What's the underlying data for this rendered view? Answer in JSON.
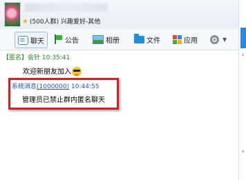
{
  "group": {
    "member_info": "(500人群) 兴趣爱好-其他"
  },
  "toolbar": {
    "chat_label": "聊天",
    "announcement_label": "公告",
    "album_label": "相册",
    "files_label": "文件",
    "apps_label": "应用"
  },
  "messages": [
    {
      "sender": "【匿名】会针",
      "time": "10:35:41",
      "body": "欢迎新朋友加入",
      "emoji": "cool-smiley"
    },
    {
      "sender": "系统消息",
      "sender_id": "(1000000)",
      "time": "10:44:55",
      "body": "管理员已禁止群内匿名聊天"
    }
  ],
  "colors": {
    "anonymous_sender": "#1a8a1a",
    "system_sender": "#1f4fd4",
    "highlight_border": "#d42020",
    "toolbar_accent": "#2b8ae0"
  }
}
